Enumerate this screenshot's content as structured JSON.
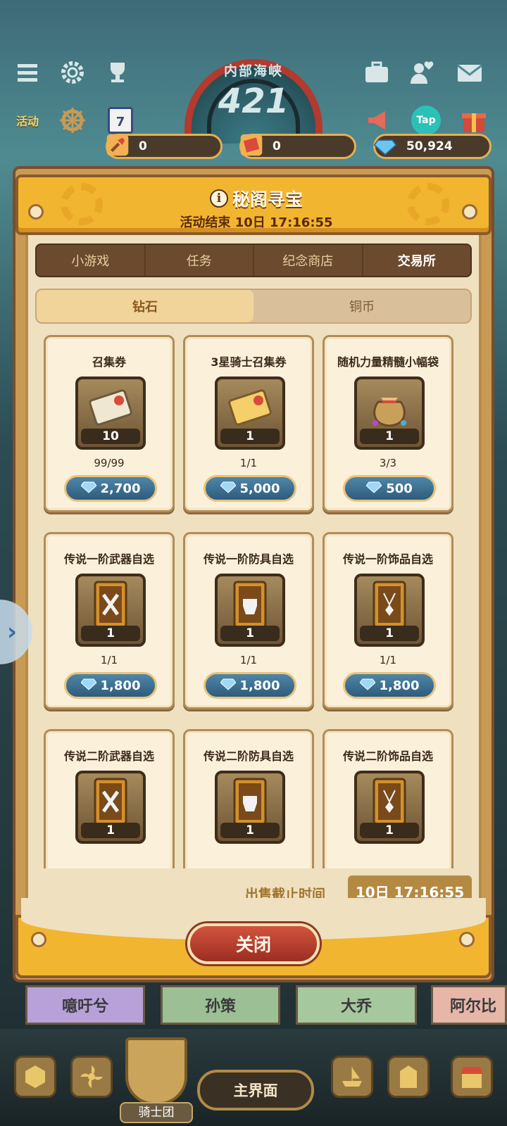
{
  "hud": {
    "gauge_subtitle": "内部海峡",
    "gauge_value": "421",
    "activity_label": "活动",
    "calendar_day": "7",
    "tap_label": "Tap",
    "resources": [
      {
        "icon": "shovel-icon",
        "value": "0"
      },
      {
        "icon": "ticket-icon",
        "value": "0"
      },
      {
        "icon": "diamond-icon",
        "value": "50,924"
      }
    ]
  },
  "panel": {
    "title": "秘阁寻宝",
    "subtitle": "活动结束 10日 17:16:55",
    "tabs": [
      "小游戏",
      "任务",
      "纪念商店",
      "交易所"
    ],
    "active_tab": "交易所",
    "subtabs": [
      "钻石",
      "铜币"
    ],
    "active_subtab": "钻石",
    "items": [
      {
        "name": "召集券",
        "icon": "summon-ticket-icon",
        "qty": "10",
        "limit": "99/99",
        "price": "2,700"
      },
      {
        "name": "3星骑士召集券",
        "icon": "gold-summon-ticket-icon",
        "qty": "1",
        "limit": "1/1",
        "price": "5,000"
      },
      {
        "name": "随机力量精髓小幅袋",
        "icon": "essence-bag-icon",
        "qty": "1",
        "limit": "3/3",
        "price": "500"
      },
      {
        "name": "传说一阶武器自选",
        "icon": "weapon-card-icon",
        "qty": "1",
        "limit": "1/1",
        "price": "1,800"
      },
      {
        "name": "传说一阶防具自选",
        "icon": "armor-card-icon",
        "qty": "1",
        "limit": "1/1",
        "price": "1,800"
      },
      {
        "name": "传说一阶饰品自选",
        "icon": "accessory-card-icon",
        "qty": "1",
        "limit": "1/1",
        "price": "1,800"
      },
      {
        "name": "传说二阶武器自选",
        "icon": "weapon-card-icon",
        "qty": "1",
        "limit": "",
        "price": ""
      },
      {
        "name": "传说二阶防具自选",
        "icon": "armor-card-icon",
        "qty": "1",
        "limit": "",
        "price": ""
      },
      {
        "name": "传说二阶饰品自选",
        "icon": "accessory-card-icon",
        "qty": "1",
        "limit": "",
        "price": ""
      }
    ],
    "sale_deadline_label": "出售截止时间",
    "sale_deadline_value": "10日 17:16:55",
    "close_label": "关闭"
  },
  "bottom": {
    "heroes": [
      "噫吁兮",
      "孙策",
      "大乔",
      "阿尔比"
    ],
    "main_label": "主界面",
    "knight_label": "骑士团"
  },
  "colors": {
    "header_gold": "#f2b52f",
    "price_blue": "#2f5c7c",
    "close_red": "#b23a2e"
  }
}
